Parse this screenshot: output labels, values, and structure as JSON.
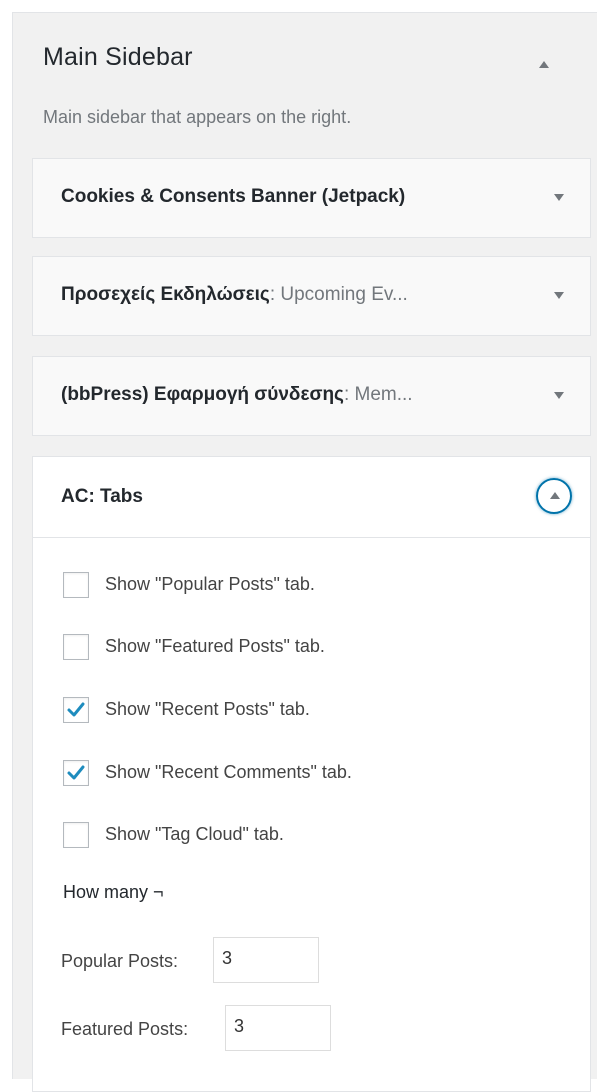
{
  "sidebar": {
    "title": "Main Sidebar",
    "description": "Main sidebar that appears on the right."
  },
  "widgets": [
    {
      "title": "Cookies & Consents Banner (Jetpack)",
      "subtitle": ""
    },
    {
      "title": "Προσεχείς Εκδηλώσεις",
      "subtitle": ": Upcoming Ev..."
    },
    {
      "title": "(bbPress) Εφαρμογή σύνδεσης",
      "subtitle": ": Mem..."
    }
  ],
  "open_widget": {
    "title": "AC: Tabs",
    "options": [
      {
        "label": "Show \"Popular Posts\" tab.",
        "checked": false
      },
      {
        "label": "Show \"Featured Posts\" tab.",
        "checked": false
      },
      {
        "label": "Show \"Recent Posts\" tab.",
        "checked": true
      },
      {
        "label": "Show \"Recent Comments\" tab.",
        "checked": true
      },
      {
        "label": "Show \"Tag Cloud\" tab.",
        "checked": false
      }
    ],
    "how_many_label": "How many ¬",
    "counts": [
      {
        "label": "Popular Posts:",
        "value": "3"
      },
      {
        "label": "Featured Posts:",
        "value": "3"
      }
    ]
  },
  "colors": {
    "accent": "#0073aa",
    "check": "#1e8cbe"
  },
  "icons": {
    "collapse": "chevron-up-icon",
    "expand": "chevron-down-icon",
    "check": "checkmark-icon"
  }
}
